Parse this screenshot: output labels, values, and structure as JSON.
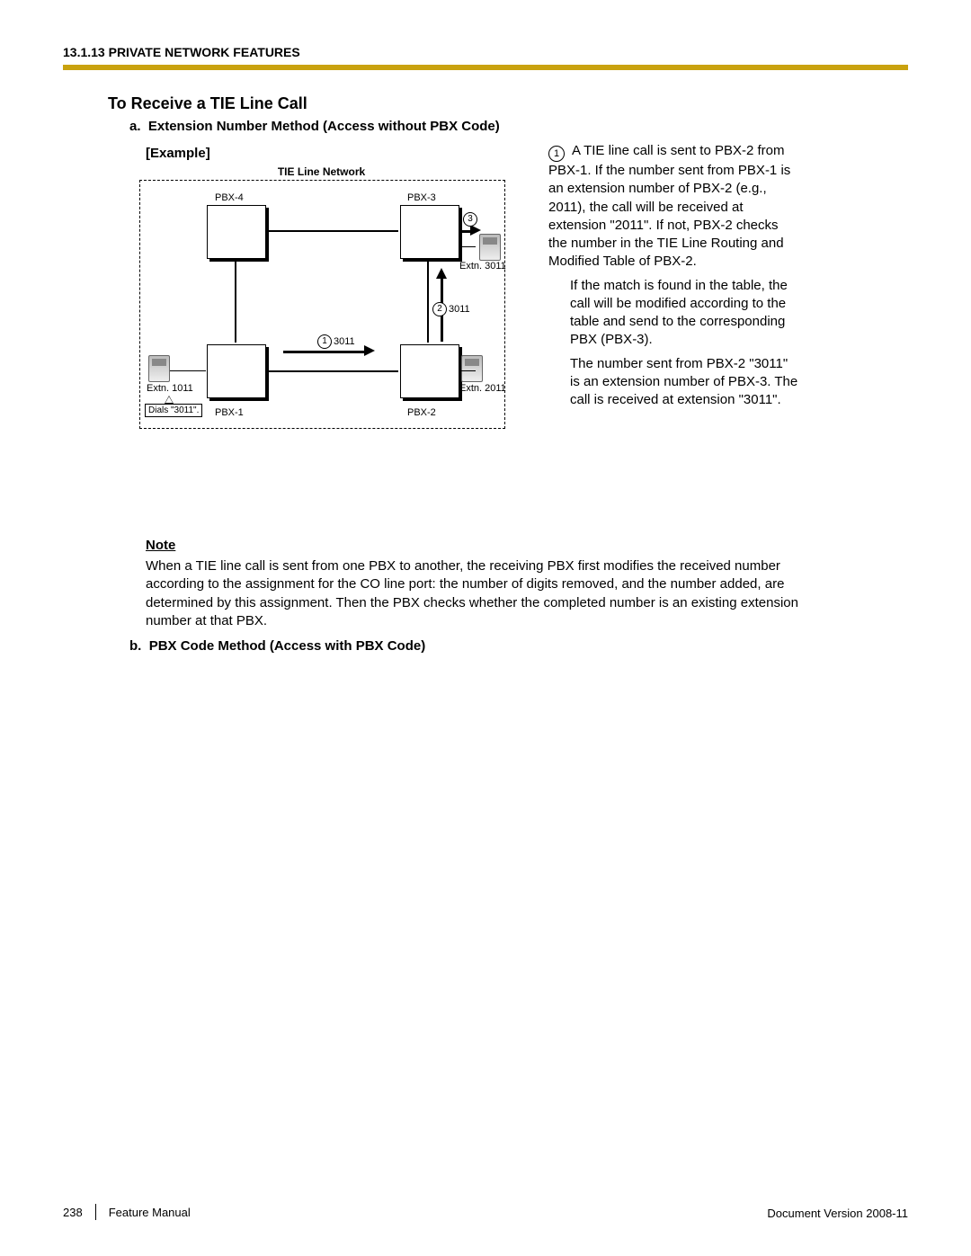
{
  "header": {
    "section": "13.1.13 PRIVATE NETWORK FEATURES"
  },
  "heading": "To Receive a TIE Line Call",
  "item_a": {
    "prefix": "a.",
    "title": "Extension Number Method (Access without PBX Code)"
  },
  "example_label": "[Example]",
  "diagram": {
    "network_title": "TIE Line Network",
    "pbx1": "PBX-1",
    "pbx2": "PBX-2",
    "pbx3": "PBX-3",
    "pbx4": "PBX-4",
    "ext1011": "Extn. 1011",
    "ext2011": "Extn. 2011",
    "ext3011": "Extn. 3011",
    "dials": "Dials \"3011\".",
    "step1_num": "1",
    "step1_txt": "3011",
    "step2_num": "2",
    "step2_txt": "3011",
    "step3_num": "3"
  },
  "desc": {
    "num1": "1",
    "p1": "A TIE line call is sent to PBX-2 from PBX-1. If the number sent from PBX-1 is an extension number of PBX-2 (e.g., 2011), the call will be received at extension \"2011\". If not, PBX-2 checks the number in the TIE Line Routing and Modified Table of PBX-2.",
    "p2": "If the match is found in the table, the call will be modified according to the table and send to the corresponding PBX (PBX-3).",
    "p3": "The number sent from PBX-2 \"3011\" is an extension number of PBX-3. The call is received at extension \"3011\"."
  },
  "note": {
    "label": "Note",
    "body": "When a TIE line call is sent from one PBX to another, the receiving PBX first modifies the received number according to the assignment for the CO line port: the number of digits removed, and the number added, are determined by this assignment. Then the PBX checks whether the completed number is an existing extension number at that PBX."
  },
  "item_b": {
    "prefix": "b.",
    "title": "PBX Code Method (Access with PBX Code)"
  },
  "footer": {
    "page": "238",
    "manual": "Feature Manual",
    "version": "Document Version  2008-11"
  }
}
